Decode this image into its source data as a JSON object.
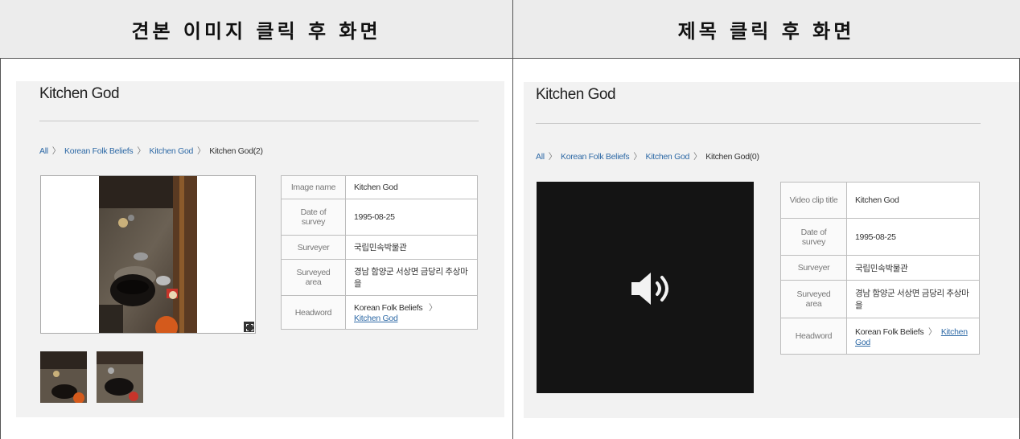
{
  "header": {
    "left_title": "견본 이미지 클릭 후 화면",
    "right_title": "제목 클릭 후 화면"
  },
  "left_panel": {
    "title": "Kitchen God",
    "breadcrumb": {
      "all": "All",
      "sep": "〉",
      "level1": "Korean Folk Beliefs",
      "level2": "Kitchen God",
      "current": "Kitchen God(2)"
    },
    "table": {
      "rows": [
        {
          "key": "Image name",
          "value": "Kitchen God"
        },
        {
          "key": "Date of survey",
          "value": "1995-08-25"
        },
        {
          "key": "Surveyer",
          "value": "국립민속박물관"
        },
        {
          "key": "Surveyed area",
          "value": "경남 함양군 서상면 금당리 추상마을"
        }
      ],
      "headword": {
        "key": "Headword",
        "prefix": "Korean Folk Beliefs",
        "sep": "〉",
        "link": "Kitchen God"
      }
    },
    "expand_icon": "expand-icon",
    "thumbnails": 2
  },
  "right_panel": {
    "title": "Kitchen God",
    "breadcrumb": {
      "all": "All",
      "sep": "〉",
      "level1": "Korean Folk Beliefs",
      "level2": "Kitchen God",
      "current": "Kitchen God(0)"
    },
    "table": {
      "rows": [
        {
          "key": "Video clip title",
          "value": "Kitchen God"
        },
        {
          "key": "Date of survey",
          "value": "1995-08-25"
        },
        {
          "key": "Surveyer",
          "value": "국립민속박물관"
        },
        {
          "key": "Surveyed area",
          "value": "경남 함양군 서상면 금당리 추상마을"
        }
      ],
      "headword": {
        "key": "Headword",
        "prefix": "Korean Folk Beliefs",
        "sep": "〉",
        "link": "Kitchen God"
      }
    },
    "video_icon": "speaker-icon"
  }
}
